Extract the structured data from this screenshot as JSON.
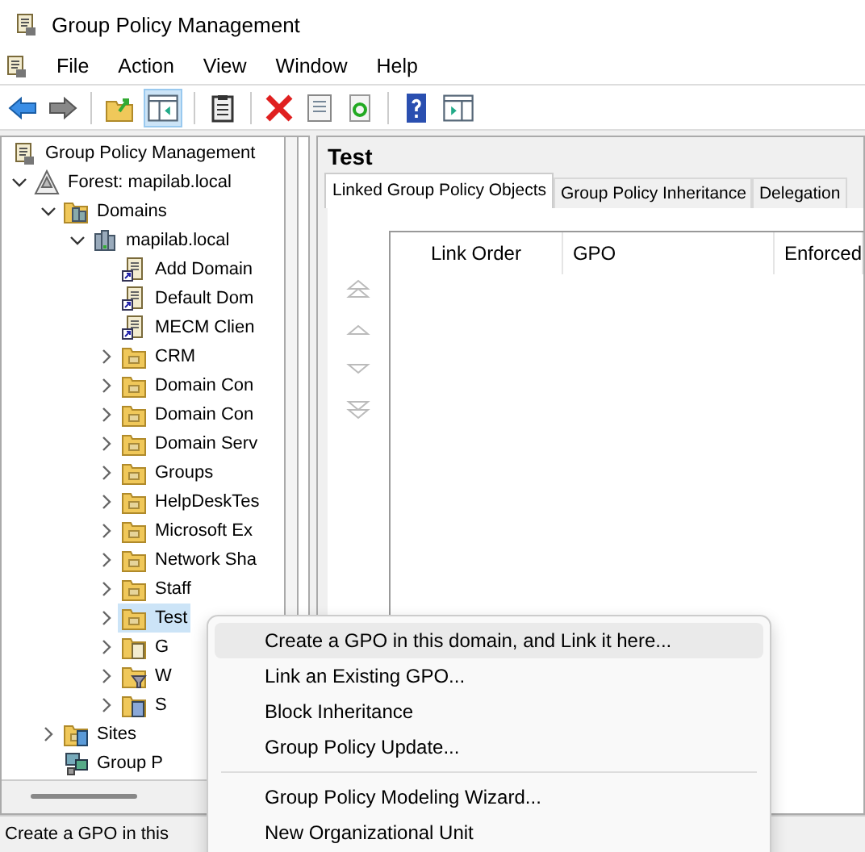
{
  "window": {
    "title": "Group Policy Management"
  },
  "menu_bar": [
    "File",
    "Action",
    "View",
    "Window",
    "Help"
  ],
  "tree": [
    {
      "label": "Group Policy Management",
      "kind": "console",
      "selected": false,
      "children": [
        {
          "label": "Forest: mapilab.local",
          "kind": "forest",
          "expanded": true,
          "selected": false,
          "children": [
            {
              "label": "Domains",
              "kind": "domains",
              "expanded": true,
              "selected": false,
              "children": [
                {
                  "label": "mapilab.local",
                  "kind": "domain",
                  "expanded": true,
                  "selected": false,
                  "children": [
                    {
                      "label": "Add Domain",
                      "kind": "gpo-link",
                      "selected": false
                    },
                    {
                      "label": "Default Dom",
                      "kind": "gpo-link",
                      "selected": false
                    },
                    {
                      "label": "MECM Clien",
                      "kind": "gpo-link",
                      "selected": false
                    },
                    {
                      "label": "CRM",
                      "kind": "ou",
                      "expanded": false,
                      "selected": false
                    },
                    {
                      "label": "Domain Con",
                      "kind": "ou",
                      "expanded": false,
                      "selected": false
                    },
                    {
                      "label": "Domain Con",
                      "kind": "ou",
                      "expanded": false,
                      "selected": false
                    },
                    {
                      "label": "Domain Serv",
                      "kind": "ou",
                      "expanded": false,
                      "selected": false
                    },
                    {
                      "label": "Groups",
                      "kind": "ou",
                      "expanded": false,
                      "selected": false
                    },
                    {
                      "label": "HelpDeskTes",
                      "kind": "ou",
                      "expanded": false,
                      "selected": false
                    },
                    {
                      "label": "Microsoft Ex",
                      "kind": "ou",
                      "expanded": false,
                      "selected": false
                    },
                    {
                      "label": "Network Sha",
                      "kind": "ou",
                      "expanded": false,
                      "selected": false
                    },
                    {
                      "label": "Staff",
                      "kind": "ou",
                      "expanded": false,
                      "selected": false
                    },
                    {
                      "label": "Test",
                      "kind": "ou",
                      "expanded": false,
                      "selected": true
                    },
                    {
                      "label": "G",
                      "kind": "gpo-folder",
                      "expanded": false,
                      "selected": false
                    },
                    {
                      "label": "W",
                      "kind": "wmi-folder",
                      "expanded": false,
                      "selected": false
                    },
                    {
                      "label": "S",
                      "kind": "starter-folder",
                      "expanded": false,
                      "selected": false
                    }
                  ]
                }
              ]
            },
            {
              "label": "Sites",
              "kind": "sites",
              "expanded": false,
              "selected": false
            },
            {
              "label": "Group P",
              "kind": "modeling",
              "selected": false
            }
          ]
        }
      ]
    }
  ],
  "details": {
    "title": "Test",
    "tabs": [
      {
        "label": "Linked Group Policy Objects",
        "selected": true
      },
      {
        "label": "Group Policy Inheritance",
        "selected": false
      },
      {
        "label": "Delegation",
        "selected": false
      }
    ],
    "columns": [
      "Link Order",
      "GPO",
      "Enforced"
    ]
  },
  "context_menu": {
    "items": [
      {
        "label": "Create a GPO in this domain, and Link it here...",
        "highlighted": true,
        "separator_before": false
      },
      {
        "label": "Link an Existing GPO...",
        "highlighted": false,
        "separator_before": false
      },
      {
        "label": "Block Inheritance",
        "highlighted": false,
        "separator_before": false
      },
      {
        "label": "Group Policy Update...",
        "highlighted": false,
        "separator_before": false
      },
      {
        "label": "Group Policy Modeling Wizard...",
        "highlighted": false,
        "separator_before": true
      },
      {
        "label": "New Organizational Unit",
        "highlighted": false,
        "separator_before": false
      }
    ]
  },
  "status_bar": {
    "text": "Create a GPO in this"
  }
}
